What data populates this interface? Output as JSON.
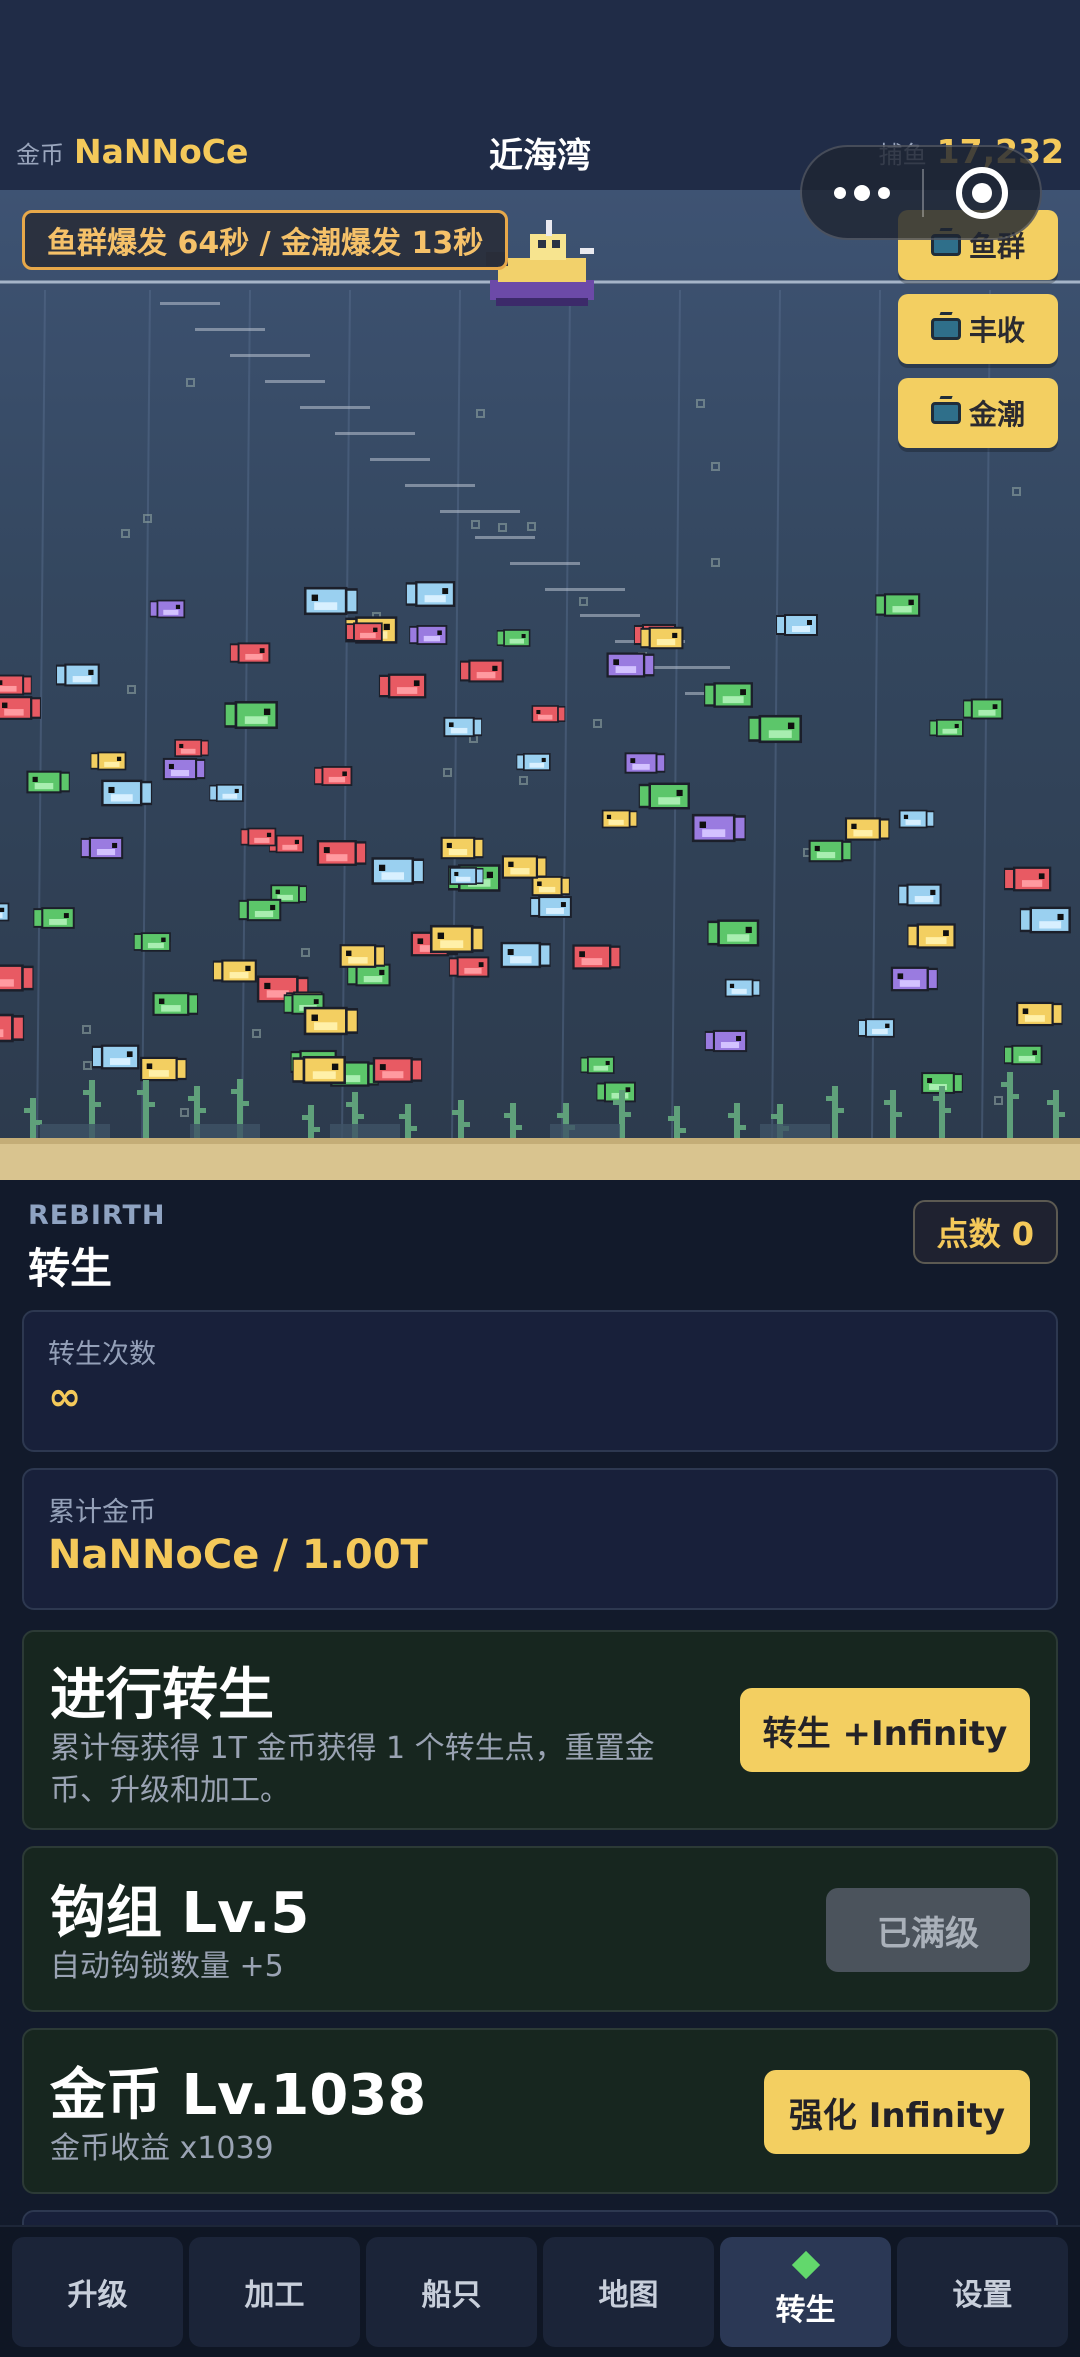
{
  "header": {
    "coins_label": "金币",
    "coins_value": "NaNNoCe",
    "location": "近海湾",
    "catch_label": "捕鱼",
    "catch_value": "17,232"
  },
  "sea": {
    "event_banner": "鱼群爆发 64秒 / 金潮爆发 13秒",
    "ad_buttons": [
      {
        "label": "鱼群",
        "icon": "tv-icon"
      },
      {
        "label": "丰收",
        "icon": "tv-icon"
      },
      {
        "label": "金潮",
        "icon": "tv-icon"
      }
    ]
  },
  "rebirth": {
    "eyebrow": "REBIRTH",
    "title": "转生",
    "points_label": "点数 0",
    "stats": [
      {
        "label": "转生次数",
        "value": "∞"
      },
      {
        "label": "累计金币",
        "value": "NaNNoCe / 1.00T"
      }
    ],
    "action": {
      "title": "进行转生",
      "desc_line1": "累计每获得 1T 金币获得 1 个转生点，重置金",
      "desc_line2": "币、升级和加工。",
      "button": "转生 +Infinity"
    },
    "upgrades": [
      {
        "title": "钩组 Lv.5",
        "desc": "自动钩锁数量 +5",
        "button": "已满级",
        "maxed": true
      },
      {
        "title": "金币 Lv.1038",
        "desc": "金币收益 x1039",
        "button": "强化 Infinity",
        "maxed": false
      }
    ]
  },
  "nav": {
    "tabs": [
      "升级",
      "加工",
      "船只",
      "地图",
      "转生",
      "设置"
    ],
    "active": "转生"
  },
  "colors": {
    "gold": "#f3cf61",
    "panel_bg": "#121a2b",
    "active_green": "#62d86c"
  }
}
